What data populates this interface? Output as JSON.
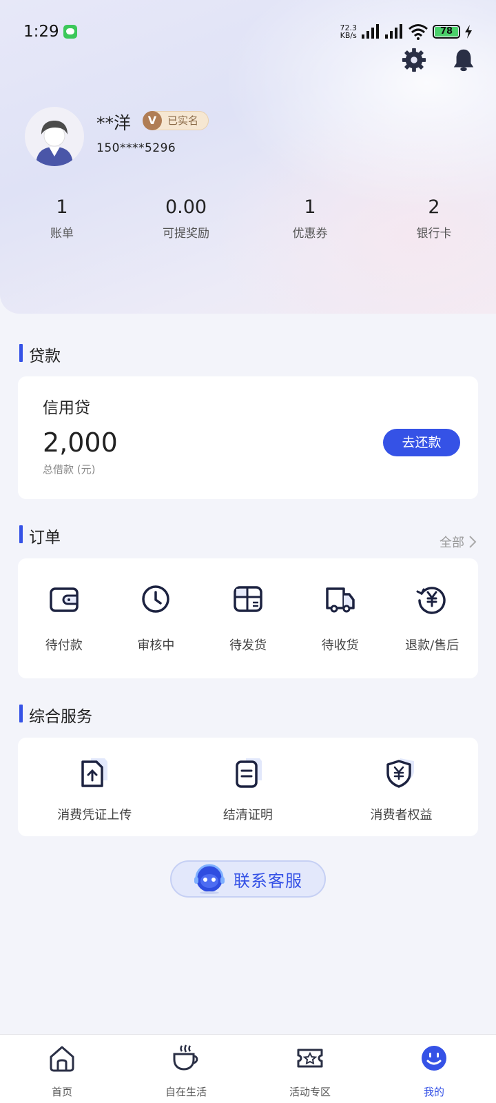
{
  "status_bar": {
    "time": "1:29",
    "speed_value": "72.3",
    "speed_unit": "KB/s",
    "battery": "78"
  },
  "header": {
    "settings_icon": "gear-icon",
    "notification_icon": "bell-icon"
  },
  "profile": {
    "name": "**洋",
    "verify_badge": "V",
    "verify_label": "已实名",
    "phone": "150****5296"
  },
  "stats": [
    {
      "value": "1",
      "label": "账单"
    },
    {
      "value": "0.00",
      "label": "可提奖励"
    },
    {
      "value": "1",
      "label": "优惠券"
    },
    {
      "value": "2",
      "label": "银行卡"
    }
  ],
  "loan": {
    "section_title": "贷款",
    "product_name": "信用贷",
    "amount": "2,000",
    "amount_label": "总借款 (元)",
    "repay_button": "去还款"
  },
  "orders": {
    "section_title": "订单",
    "all_link": "全部",
    "items": [
      {
        "label": "待付款",
        "icon": "wallet-icon"
      },
      {
        "label": "审核中",
        "icon": "clock-icon"
      },
      {
        "label": "待发货",
        "icon": "package-icon"
      },
      {
        "label": "待收货",
        "icon": "truck-icon"
      },
      {
        "label": "退款/售后",
        "icon": "refund-yen-icon"
      }
    ]
  },
  "services": {
    "section_title": "综合服务",
    "items": [
      {
        "label": "消费凭证上传",
        "icon": "upload-document-icon"
      },
      {
        "label": "结清证明",
        "icon": "certificate-icon"
      },
      {
        "label": "消费者权益",
        "icon": "shield-yen-icon"
      }
    ]
  },
  "customer_service": {
    "label": "联系客服",
    "icon": "robot-headset-icon"
  },
  "tabbar": {
    "active": "我的",
    "items": [
      {
        "label": "首页",
        "icon": "home-icon"
      },
      {
        "label": "自在生活",
        "icon": "coffee-cup-icon"
      },
      {
        "label": "活动专区",
        "icon": "ticket-star-icon"
      },
      {
        "label": "我的",
        "icon": "smiley-icon"
      }
    ]
  },
  "colors": {
    "accent": "#3552e6",
    "badge_bg": "#f6e7d2",
    "badge_text": "#8a6a48"
  }
}
